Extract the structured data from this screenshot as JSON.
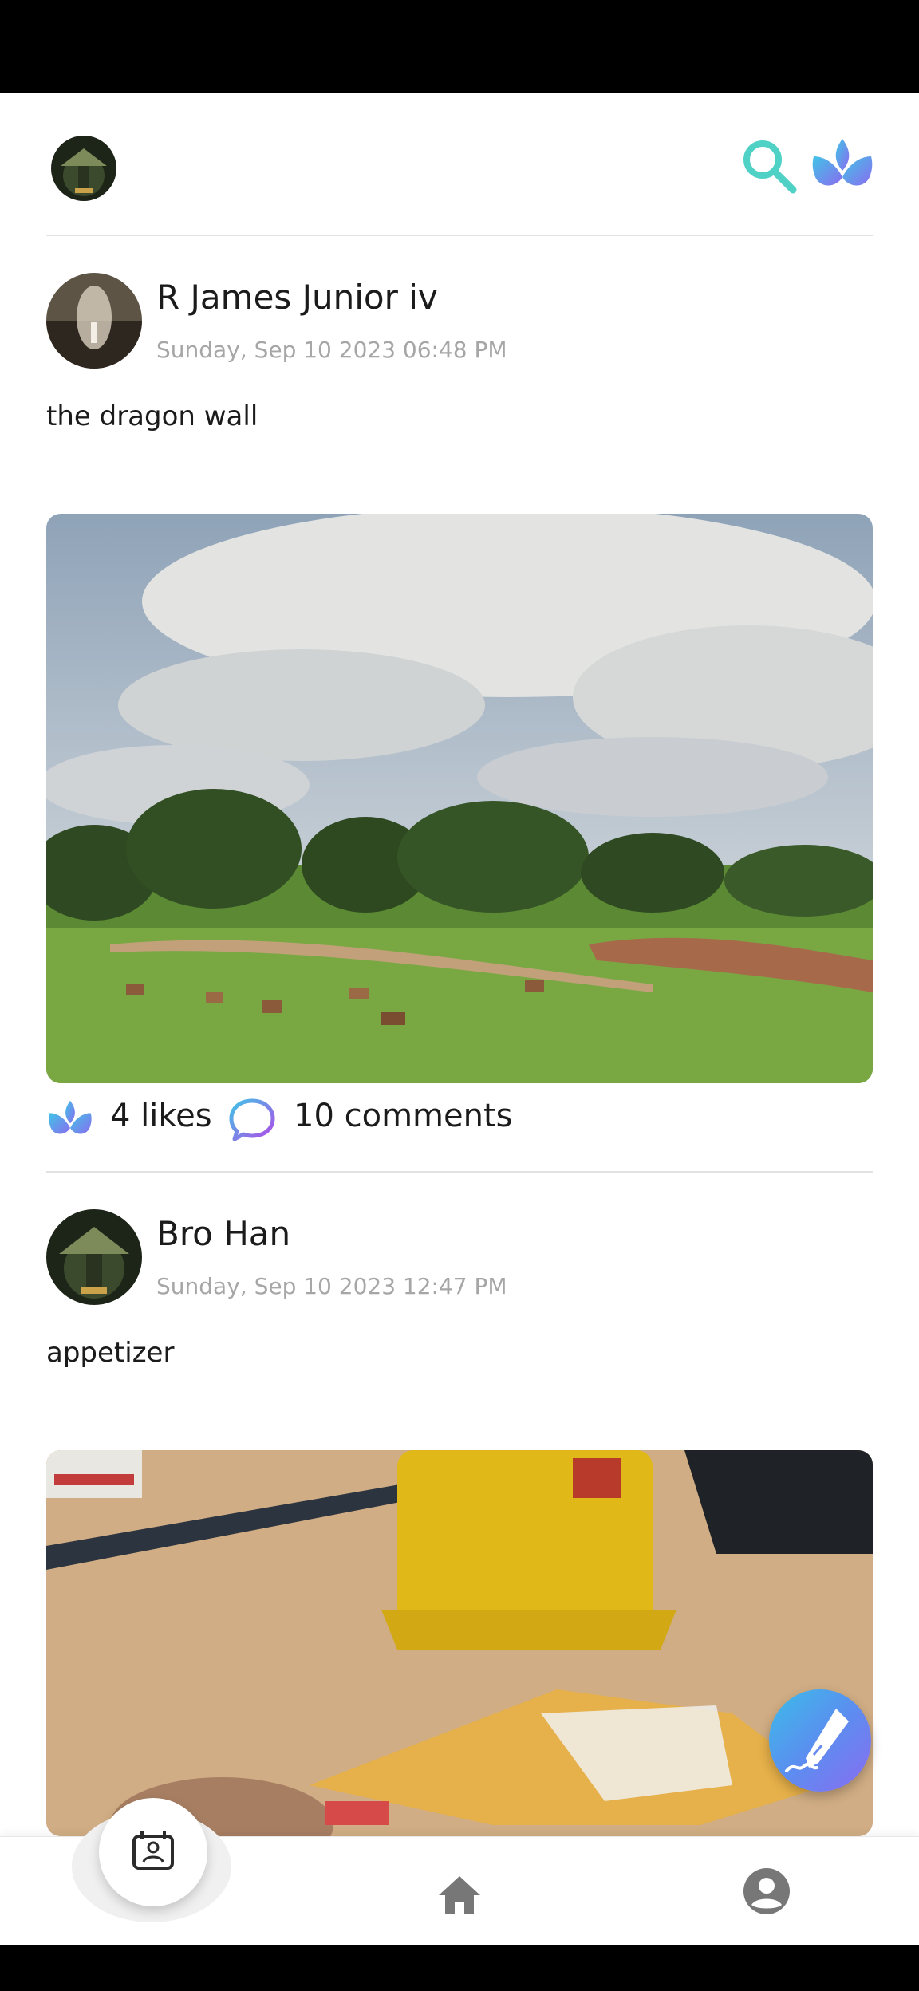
{
  "header": {
    "avatar_icon": "user-avatar",
    "search_icon": "search-icon",
    "lotus_icon": "lotus-icon",
    "accent_color": "#4fd1c5"
  },
  "posts": [
    {
      "author": "R James Junior iv",
      "date": "Sunday, Sep 10 2023 06:48 PM",
      "text": "the dragon wall",
      "likes": "4 likes",
      "comments": "10 comments"
    },
    {
      "author": "Bro Han",
      "date": "Sunday, Sep 10 2023 12:47 PM",
      "text": "appetizer"
    }
  ],
  "fab": {
    "icon": "pen-icon"
  },
  "bottom_nav": {
    "items": [
      {
        "icon": "contacts-icon"
      },
      {
        "icon": "home-icon"
      },
      {
        "icon": "profile-icon"
      }
    ]
  }
}
